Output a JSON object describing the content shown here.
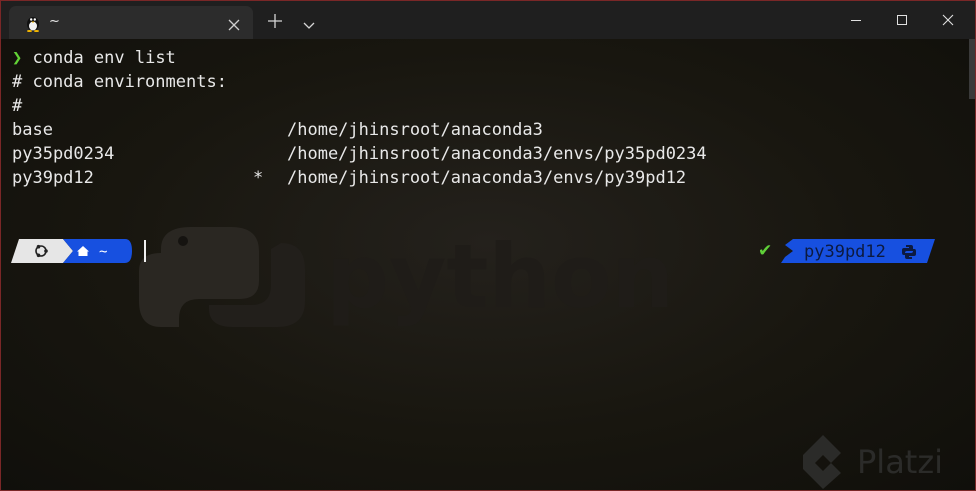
{
  "tab": {
    "title": "~",
    "icon": "linux-tux-icon"
  },
  "terminal": {
    "lines": [
      {
        "prompt_symbol": "❯",
        "command": "conda env list"
      },
      {
        "text": "# conda environments:"
      },
      {
        "text": "#"
      }
    ],
    "environments": [
      {
        "name": "base",
        "marker": "",
        "path": "/home/jhinsroot/anaconda3"
      },
      {
        "name": "py35pd0234",
        "marker": "",
        "path": "/home/jhinsroot/anaconda3/envs/py35pd0234"
      },
      {
        "name": "py39pd12",
        "marker": "*",
        "path": "/home/jhinsroot/anaconda3/envs/py39pd12"
      }
    ]
  },
  "prompt": {
    "os_icon": "ubuntu-icon",
    "home_icon": "home-icon",
    "cwd": "~",
    "status_icon": "check-icon",
    "status_text": "✔",
    "env_name": "py39pd12",
    "env_icon": "python-icon",
    "colors": {
      "os_segment": "#e6e6e6",
      "path_segment": "#1750e0",
      "env_segment": "#1750e0",
      "status": "#5fd038"
    }
  },
  "watermark": {
    "text": "python",
    "brand": "Platzi"
  }
}
